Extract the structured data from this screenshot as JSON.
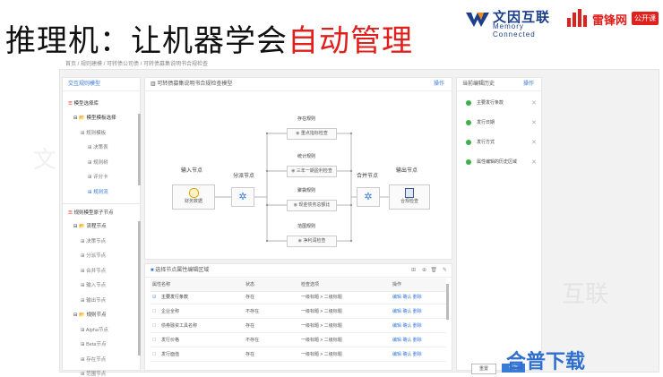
{
  "slide": {
    "title_main": "推理机：让机器学会",
    "title_highlight": "自动管理",
    "logo_left_cn": "文因互联",
    "logo_left_en": "Memory Connected",
    "logo_right_cn": "雷锋网",
    "logo_right_badge": "公开课",
    "corner_logo": "合普下载"
  },
  "breadcrumb": "首页 / 规则建模 / 可转债公司债 / 可转债募集说明书合规检查",
  "left_panel": {
    "header": "交互规则模型",
    "section1_title": "模型选择库",
    "section1_items": [
      {
        "label": "模型模板选择",
        "level": 1,
        "bold": true
      },
      {
        "label": "规则模板",
        "level": 2
      },
      {
        "label": "决策表",
        "level": 3
      },
      {
        "label": "规则树",
        "level": 3
      },
      {
        "label": "评分卡",
        "level": 3
      },
      {
        "label": "规则流",
        "level": 3,
        "selected": true
      }
    ],
    "section2_title": "规则模型原子节点",
    "section2_items": [
      {
        "label": "流程节点",
        "level": 1,
        "bold": true
      },
      {
        "label": "决策节点",
        "level": 2
      },
      {
        "label": "分派节点",
        "level": 2
      },
      {
        "label": "合并节点",
        "level": 2
      },
      {
        "label": "输入节点",
        "level": 2
      },
      {
        "label": "输出节点",
        "level": 2
      },
      {
        "label": "规则节点",
        "level": 1,
        "bold": true
      },
      {
        "label": "Alpha节点",
        "level": 2
      },
      {
        "label": "Beta节点",
        "level": 2
      },
      {
        "label": "存在节点",
        "level": 2
      },
      {
        "label": "范围节点",
        "level": 2
      }
    ]
  },
  "center_panel": {
    "header": "可转债募集说明书合规检查模型",
    "header_action": "操作",
    "nodes": {
      "input_title": "输入节点",
      "input_box": "财务数据",
      "split_title": "分派节点",
      "merge_title": "合并节点",
      "output_title": "输出节点",
      "output_box": "合规检查",
      "rules": [
        {
          "group": "存在规则",
          "box": "重点指标检查"
        },
        {
          "group": "统计规则",
          "box": "三年一期盈利检查"
        },
        {
          "group": "聚袋规则",
          "box": "现金债务总额比"
        },
        {
          "group": "范围规则",
          "box": "净利润检查"
        }
      ]
    }
  },
  "attr_panel": {
    "header": "选择节点属性编辑区域",
    "columns": [
      "属性名称",
      "状态",
      "检查选项",
      "操作"
    ],
    "rows": [
      {
        "name": "主要发行条款",
        "checked": true,
        "status": "存在",
        "option": "一级标题 > 二级标题",
        "ops": "编辑  确认  删除"
      },
      {
        "name": "企业全称",
        "checked": false,
        "status": "不存在",
        "option": "一级标题 > 二级标题",
        "ops": "编辑  确认  删除"
      },
      {
        "name": "债券融资工具名称",
        "checked": false,
        "status": "存在",
        "option": "一级标题 > 二级标题",
        "ops": "编辑  确认  删除"
      },
      {
        "name": "发行价格",
        "checked": false,
        "status": "不存在",
        "option": "一级标题 > 二级标题",
        "ops": "编辑  确认  删除"
      },
      {
        "name": "发行面值",
        "checked": false,
        "status": "存在",
        "option": "一级标题 > 二级标题",
        "ops": "编辑  确认  删除"
      }
    ]
  },
  "right_panel": {
    "header": "当前编辑历史",
    "header_action": "操作",
    "items": [
      "主要发行条款",
      "发行日期",
      "发行方式",
      "属性编辑的历史区域"
    ],
    "reset_label": "重置",
    "save_label": "保存"
  },
  "colors": {
    "accent": "#3a7bd5",
    "title_red": "#e0201c",
    "ok_green": "#3cb04a"
  }
}
